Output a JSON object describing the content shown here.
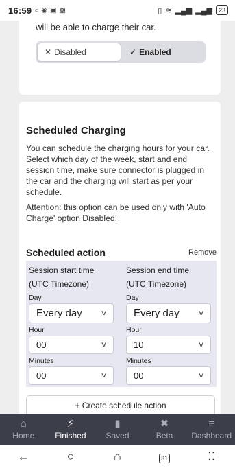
{
  "status_bar": {
    "time": "16:59",
    "battery": "23"
  },
  "auto_charge": {
    "description": "will be able to charge their car.",
    "toggle": {
      "disabled_label": "Disabled",
      "enabled_label": "Enabled",
      "selected": "Enabled"
    }
  },
  "scheduled": {
    "title": "Scheduled Charging",
    "description": "You can schedule the charging hours for your car. Select which day of the week, start and end session time, make sure connector is plugged in the car and the charging will start as per your schedule.",
    "attention": "Attention: this option can be used only with 'Auto Charge' option Disabled!",
    "action": {
      "title": "Scheduled action",
      "remove_label": "Remove",
      "start": {
        "heading": "Session start time",
        "timezone": "(UTC Timezone)",
        "day_label": "Day",
        "day_value": "Every day",
        "hour_label": "Hour",
        "hour_value": "00",
        "minutes_label": "Minutes",
        "minutes_value": "00"
      },
      "end": {
        "heading": "Session end time",
        "timezone": "(UTC Timezone)",
        "day_label": "Day",
        "day_value": "Every day",
        "hour_label": "Hour",
        "hour_value": "10",
        "minutes_label": "Minutes",
        "minutes_value": "00"
      }
    },
    "create_label": "+ Create schedule action"
  },
  "bottom_nav": [
    {
      "label": "Home",
      "icon": "home-icon",
      "active": false
    },
    {
      "label": "Finished",
      "icon": "bolt-icon",
      "active": true
    },
    {
      "label": "Saved",
      "icon": "bookmark-icon",
      "active": false
    },
    {
      "label": "Beta",
      "icon": "tools-icon",
      "active": false
    },
    {
      "label": "Dashboard",
      "icon": "menu-icon",
      "active": false
    }
  ],
  "system_nav": {
    "calendar_day": "31"
  }
}
